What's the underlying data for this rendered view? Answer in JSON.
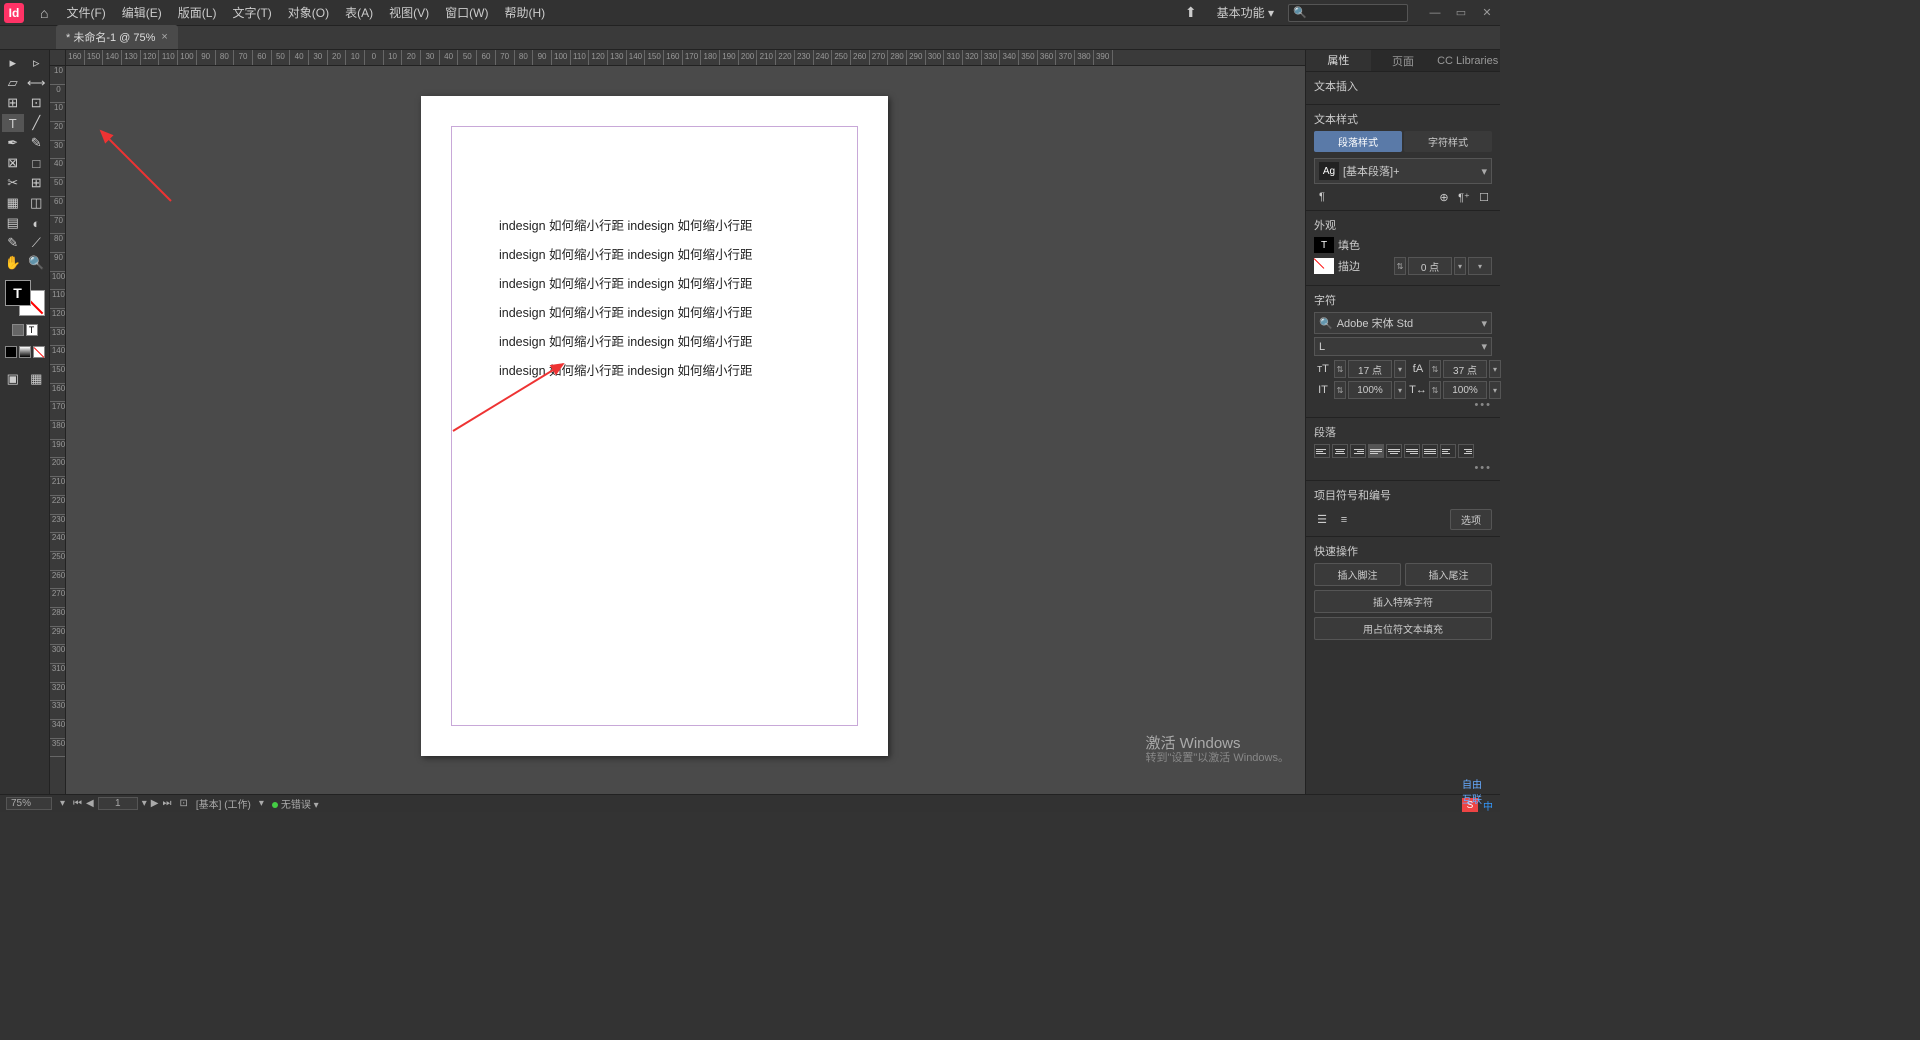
{
  "menubar": {
    "app_letter": "Id",
    "menus": [
      "文件(F)",
      "编辑(E)",
      "版面(L)",
      "文字(T)",
      "对象(O)",
      "表(A)",
      "视图(V)",
      "窗口(W)",
      "帮助(H)"
    ],
    "workspace": "基本功能",
    "search_placeholder": "🔍"
  },
  "tab": {
    "title": "* 未命名-1 @ 75%"
  },
  "ruler_h": [
    "160",
    "150",
    "140",
    "130",
    "120",
    "110",
    "100",
    "90",
    "80",
    "70",
    "60",
    "50",
    "40",
    "30",
    "20",
    "10",
    "0",
    "10",
    "20",
    "30",
    "40",
    "50",
    "60",
    "70",
    "80",
    "90",
    "100",
    "110",
    "120",
    "130",
    "140",
    "150",
    "160",
    "170",
    "180",
    "190",
    "200",
    "210",
    "220",
    "230",
    "240",
    "250",
    "260",
    "270",
    "280",
    "290",
    "300",
    "310",
    "320",
    "330",
    "340",
    "350",
    "360",
    "370",
    "380",
    "390"
  ],
  "ruler_v": [
    "10",
    "0",
    "10",
    "20",
    "30",
    "40",
    "50",
    "60",
    "70",
    "80",
    "90",
    "100",
    "110",
    "120",
    "130",
    "140",
    "150",
    "160",
    "170",
    "180",
    "190",
    "200",
    "210",
    "220",
    "230",
    "240",
    "250",
    "260",
    "270",
    "280",
    "290",
    "300",
    "310",
    "320",
    "330",
    "340",
    "350"
  ],
  "document": {
    "lines": [
      "indesign 如何缩小行距 indesign 如何缩小行距",
      "indesign 如何缩小行距 indesign 如何缩小行距",
      "indesign 如何缩小行距 indesign 如何缩小行距",
      "indesign 如何缩小行距 indesign 如何缩小行距",
      "indesign 如何缩小行距 indesign 如何缩小行距",
      "indesign 如何缩小行距 indesign 如何缩小行距"
    ]
  },
  "panels": {
    "tabs": {
      "properties": "属性",
      "pages": "页面",
      "cc": "CC Libraries"
    },
    "text_insert": "文本插入",
    "text_style": {
      "title": "文本样式",
      "para_tab": "段落样式",
      "char_tab": "字符样式",
      "current": "[基本段落]+"
    },
    "appearance": {
      "title": "外观",
      "fill": "填色",
      "stroke": "描边",
      "stroke_val": "0 点"
    },
    "character": {
      "title": "字符",
      "font": "Adobe 宋体 Std",
      "style": "L",
      "size": "17 点",
      "leading": "37 点",
      "hscale": "100%",
      "vscale": "100%"
    },
    "paragraph": {
      "title": "段落"
    },
    "bullets": {
      "title": "项目符号和编号",
      "options": "选项"
    },
    "quick": {
      "title": "快速操作",
      "footnote": "插入脚注",
      "endnote": "插入尾注",
      "special": "插入特殊字符",
      "placeholder": "用占位符文本填充"
    }
  },
  "watermark": {
    "l1": "激活 Windows",
    "l2": "转到\"设置\"以激活 Windows。"
  },
  "logo": "自由互联",
  "statusbar": {
    "zoom": "75%",
    "page": "1",
    "layout": "[基本] (工作)",
    "errors": "无错误"
  }
}
